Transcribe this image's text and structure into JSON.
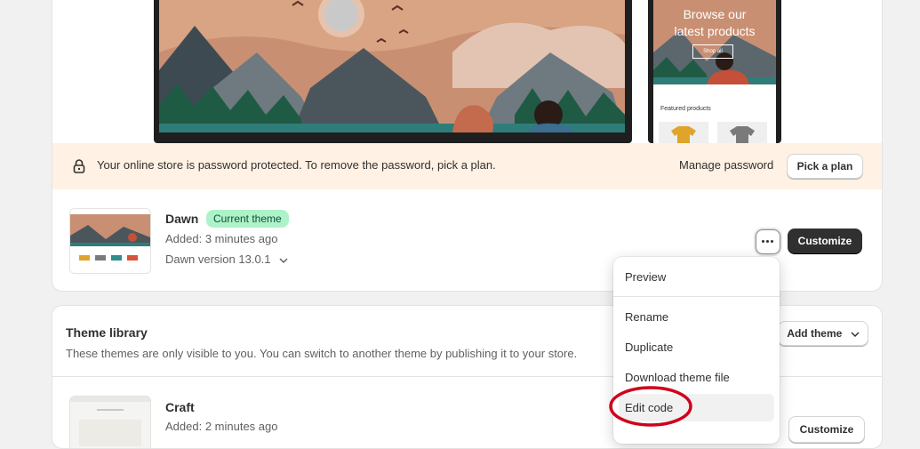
{
  "preview": {
    "mobile_headline_line1": "Browse our",
    "mobile_headline_line2": "latest products",
    "mobile_shop_button": "Shop all",
    "mobile_featured": "Featured products"
  },
  "banner": {
    "text": "Your online store is password protected. To remove the password, pick a plan.",
    "manage_password": "Manage password",
    "pick_plan": "Pick a plan",
    "icon": "lock-icon",
    "background": "#fff1e3"
  },
  "current_theme": {
    "name": "Dawn",
    "badge": "Current theme",
    "added": "Added: 3 minutes ago",
    "version": "Dawn version 13.0.1",
    "customize": "Customize",
    "badge_color": "#aef2c9"
  },
  "menu": {
    "items": [
      "Preview",
      "Rename",
      "Duplicate",
      "Download theme file",
      "Edit code"
    ],
    "highlighted": "Edit code"
  },
  "library": {
    "title": "Theme library",
    "description": "These themes are only visible to you. You can switch to another theme by publishing it to your store.",
    "add_theme": "Add theme",
    "themes": [
      {
        "name": "Craft",
        "added": "Added: 2 minutes ago",
        "customize": "Customize"
      }
    ]
  },
  "annotation_color": "#d0021b"
}
